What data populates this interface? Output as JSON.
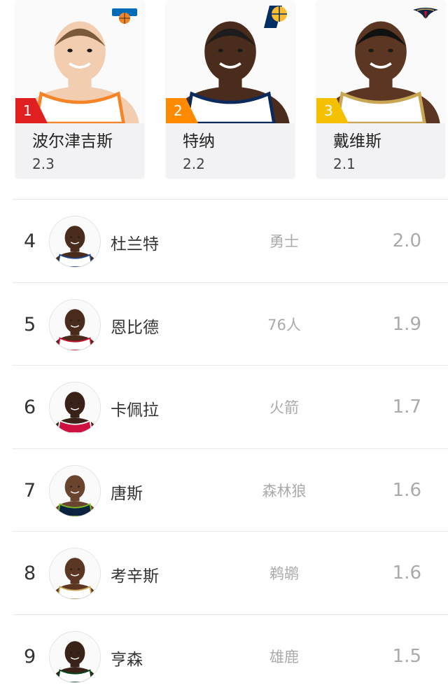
{
  "top3": [
    {
      "rank": "1",
      "name": "波尔津吉斯",
      "value": "2.3",
      "flag_color": "#e02020",
      "team_logo": "knicks-logo",
      "skin": "#f2cdb0",
      "hair": "#7a5a3a",
      "jersey": "#ffffff",
      "trim": "#f58426"
    },
    {
      "rank": "2",
      "name": "特纳",
      "value": "2.2",
      "flag_color": "#ff8a00",
      "team_logo": "pacers-logo",
      "skin": "#4a2c1c",
      "hair": "#1c1c1c",
      "jersey": "#ffffff",
      "trim": "#0d2a5c"
    },
    {
      "rank": "3",
      "name": "戴维斯",
      "value": "2.1",
      "flag_color": "#f5c000",
      "team_logo": "pelicans-logo",
      "skin": "#5b3622",
      "hair": "#111111",
      "jersey": "#ffffff",
      "trim": "#c9a653"
    }
  ],
  "list": [
    {
      "rank": "4",
      "name": "杜兰特",
      "team": "勇士",
      "value": "2.0",
      "skin": "#4a2c1c",
      "jersey": "#ffffff",
      "trim": "#1d428a"
    },
    {
      "rank": "5",
      "name": "恩比德",
      "team": "76人",
      "value": "1.9",
      "skin": "#4a2c1c",
      "jersey": "#ffffff",
      "trim": "#c8102e"
    },
    {
      "rank": "6",
      "name": "卡佩拉",
      "team": "火箭",
      "value": "1.7",
      "skin": "#3a2218",
      "jersey": "#ce1141",
      "trim": "#ffffff"
    },
    {
      "rank": "7",
      "name": "唐斯",
      "team": "森林狼",
      "value": "1.6",
      "skin": "#6b4430",
      "jersey": "#0c2340",
      "trim": "#78be20"
    },
    {
      "rank": "8",
      "name": "考辛斯",
      "team": "鹈鹕",
      "value": "1.6",
      "skin": "#5b3622",
      "jersey": "#ffffff",
      "trim": "#c9a653"
    },
    {
      "rank": "9",
      "name": "亨森",
      "team": "雄鹿",
      "value": "1.5",
      "skin": "#3a2218",
      "jersey": "#ffffff",
      "trim": "#00471b"
    }
  ]
}
